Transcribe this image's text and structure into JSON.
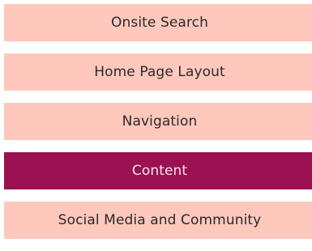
{
  "menu": {
    "items": [
      {
        "label": "Onsite Search",
        "active": false
      },
      {
        "label": "Home Page Layout",
        "active": false
      },
      {
        "label": "Navigation",
        "active": false
      },
      {
        "label": "Content",
        "active": true
      },
      {
        "label": "Social Media and Community",
        "active": false
      }
    ]
  },
  "colors": {
    "item_bg": "#ffc8bd",
    "active_bg": "#9b1152",
    "item_text": "#2a2a2a",
    "active_text": "#fbe4ec"
  }
}
